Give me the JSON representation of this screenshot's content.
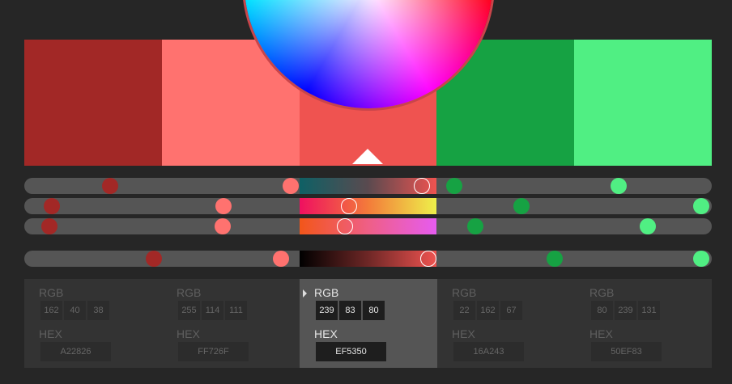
{
  "colors": [
    {
      "hex": "A22826",
      "rgb": [
        162,
        40,
        38
      ],
      "swatch": "#A22826"
    },
    {
      "hex": "FF726F",
      "rgb": [
        255,
        114,
        111
      ],
      "swatch": "#FF726F"
    },
    {
      "hex": "EF5350",
      "rgb": [
        239,
        83,
        80
      ],
      "swatch": "#EF5350"
    },
    {
      "hex": "16A243",
      "rgb": [
        22,
        162,
        67
      ],
      "swatch": "#16A243"
    },
    {
      "hex": "50EF83",
      "rgb": [
        80,
        239,
        131
      ],
      "swatch": "#50EF83"
    }
  ],
  "active_index": 2,
  "labels": {
    "rgb": "RGB",
    "hex": "HEX"
  },
  "sliders": [
    {
      "name": "hue",
      "gradient": "linear-gradient(to right,#0e6065,#5a4a4f,#ef5350)",
      "levels": [
        0.125,
        0.388,
        0.578,
        0.625,
        0.865
      ]
    },
    {
      "name": "saturation",
      "gradient": "linear-gradient(to right,#ef1060,#f37b3a,#eef04a)",
      "levels": [
        0.04,
        0.29,
        0.472,
        0.723,
        0.985
      ]
    },
    {
      "name": "lightness",
      "gradient": "linear-gradient(to right,#f2561a,#ef5f86,#e65cf0)",
      "levels": [
        0.037,
        0.288,
        0.467,
        0.656,
        0.907
      ]
    },
    {
      "name": "brightness",
      "gradient": "linear-gradient(to right,#000000,#6e2726,#ef5350)",
      "levels": [
        0.188,
        0.373,
        0.588,
        0.772,
        0.985
      ]
    }
  ]
}
